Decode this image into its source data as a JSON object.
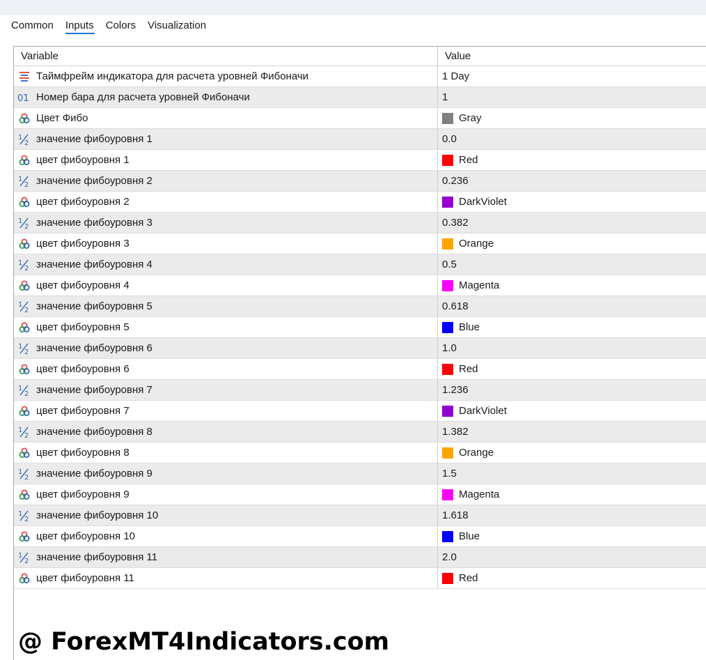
{
  "tabs": [
    {
      "label": "Common",
      "active": false
    },
    {
      "label": "Inputs",
      "active": true
    },
    {
      "label": "Colors",
      "active": false
    },
    {
      "label": "Visualization",
      "active": false
    }
  ],
  "columns": {
    "variable": "Variable",
    "value": "Value"
  },
  "rows": [
    {
      "type": "timeframe",
      "icon": "timeframe-icon",
      "name": "Таймфрейм индикатора для расчета уровней Фибоначи",
      "value": "1 Day"
    },
    {
      "type": "int",
      "icon": "integer-icon",
      "name": "Номер бара для расчета уровней Фибоначи",
      "value": "1"
    },
    {
      "type": "color",
      "icon": "color-icon",
      "name": "Цвет Фибо",
      "value": "Gray",
      "swatch": "#808080"
    },
    {
      "type": "double",
      "icon": "fraction-icon",
      "name": "значение фибоуровня 1",
      "value": "0.0"
    },
    {
      "type": "color",
      "icon": "color-icon",
      "name": "цвет фибоуровня 1",
      "value": "Red",
      "swatch": "#ff0000"
    },
    {
      "type": "double",
      "icon": "fraction-icon",
      "name": "значение фибоуровня 2",
      "value": "0.236"
    },
    {
      "type": "color",
      "icon": "color-icon",
      "name": "цвет фибоуровня 2",
      "value": "DarkViolet",
      "swatch": "#9400d3"
    },
    {
      "type": "double",
      "icon": "fraction-icon",
      "name": "значение фибоуровня 3",
      "value": "0.382"
    },
    {
      "type": "color",
      "icon": "color-icon",
      "name": "цвет фибоуровня 3",
      "value": "Orange",
      "swatch": "#ffa500"
    },
    {
      "type": "double",
      "icon": "fraction-icon",
      "name": "значение фибоуровня 4",
      "value": "0.5"
    },
    {
      "type": "color",
      "icon": "color-icon",
      "name": "цвет фибоуровня 4",
      "value": "Magenta",
      "swatch": "#ff00ff"
    },
    {
      "type": "double",
      "icon": "fraction-icon",
      "name": "значение фибоуровня 5",
      "value": "0.618"
    },
    {
      "type": "color",
      "icon": "color-icon",
      "name": "цвет фибоуровня 5",
      "value": "Blue",
      "swatch": "#0000ff"
    },
    {
      "type": "double",
      "icon": "fraction-icon",
      "name": "значение фибоуровня 6",
      "value": "1.0"
    },
    {
      "type": "color",
      "icon": "color-icon",
      "name": "цвет фибоуровня 6",
      "value": "Red",
      "swatch": "#ff0000"
    },
    {
      "type": "double",
      "icon": "fraction-icon",
      "name": "значение фибоуровня 7",
      "value": "1.236"
    },
    {
      "type": "color",
      "icon": "color-icon",
      "name": "цвет фибоуровня 7",
      "value": "DarkViolet",
      "swatch": "#9400d3"
    },
    {
      "type": "double",
      "icon": "fraction-icon",
      "name": "значение фибоуровня 8",
      "value": "1.382"
    },
    {
      "type": "color",
      "icon": "color-icon",
      "name": "цвет фибоуровня 8",
      "value": "Orange",
      "swatch": "#ffa500"
    },
    {
      "type": "double",
      "icon": "fraction-icon",
      "name": "значение фибоуровня 9",
      "value": "1.5"
    },
    {
      "type": "color",
      "icon": "color-icon",
      "name": "цвет фибоуровня 9",
      "value": "Magenta",
      "swatch": "#ff00ff"
    },
    {
      "type": "double",
      "icon": "fraction-icon",
      "name": "значение фибоуровня 10",
      "value": "1.618"
    },
    {
      "type": "color",
      "icon": "color-icon",
      "name": "цвет фибоуровня 10",
      "value": "Blue",
      "swatch": "#0000ff"
    },
    {
      "type": "double",
      "icon": "fraction-icon",
      "name": "значение фибоуровня 11",
      "value": "2.0"
    },
    {
      "type": "color",
      "icon": "color-icon",
      "name": "цвет фибоуровня 11",
      "value": "Red",
      "swatch": "#ff0000"
    }
  ],
  "watermark": "@ ForexMT4Indicators.com",
  "colors": {
    "tab_underline": "#1976d2",
    "row_alt": "#ebebeb"
  }
}
